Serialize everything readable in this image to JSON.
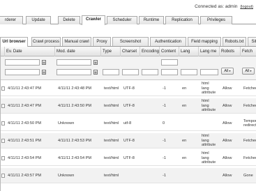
{
  "header": {
    "connected_label": "Connected as: admin",
    "logout_label": "(logout)"
  },
  "main_tabs": [
    {
      "label": "rderer"
    },
    {
      "label": "Update"
    },
    {
      "label": "Delete"
    },
    {
      "label": "Crawler"
    },
    {
      "label": "Scheduler"
    },
    {
      "label": "Runtime"
    },
    {
      "label": "Replication"
    },
    {
      "label": "Privileges"
    }
  ],
  "sub_tabs": [
    {
      "label": "Url browser"
    },
    {
      "label": "Crawl process"
    },
    {
      "label": "Manual crawl"
    },
    {
      "label": "Proxy"
    },
    {
      "label": "Screenshot"
    },
    {
      "label": "Authentication"
    },
    {
      "label": "Field mapping"
    },
    {
      "label": "Robots.txt"
    },
    {
      "label": "Sit"
    }
  ],
  "columns": [
    {
      "label": "Ev. Date"
    },
    {
      "label": "Mod. date"
    },
    {
      "label": "Type"
    },
    {
      "label": "Charset"
    },
    {
      "label": "Encoding"
    },
    {
      "label": "Content"
    },
    {
      "label": "Lang"
    },
    {
      "label": "Lang me"
    },
    {
      "label": "Robots"
    },
    {
      "label": "Fetch"
    }
  ],
  "filters": {
    "robots_select": "All",
    "fetch_select": "All"
  },
  "rows": [
    {
      "ev": "4/11/11 2:43:47 PM",
      "mod": "4/11/11 2:43:48 PM",
      "type": "text/html",
      "charset": "UTF-8",
      "content": "-1",
      "lang": "en",
      "lang_method": [
        "html",
        "lang",
        "attribute"
      ],
      "robots": "Allow",
      "fetch": [
        "Fetched"
      ]
    },
    {
      "ev": "4/11/11 2:43:47 PM",
      "mod": "4/11/11 2:43:50 PM",
      "type": "text/html",
      "charset": "UTF-8",
      "content": "-1",
      "lang": "en",
      "lang_method": [
        "html",
        "lang",
        "attribute"
      ],
      "robots": "Allow",
      "fetch": [
        "Fetched"
      ]
    },
    {
      "ev": "4/11/11 2:43:50 PM",
      "mod": "Unknown",
      "type": "text/html",
      "charset": "utf-8",
      "content": "0",
      "lang": "",
      "lang_method": [],
      "robots": "Allow",
      "fetch": [
        "Tempora",
        "redirect"
      ]
    },
    {
      "ev": "4/11/11 2:43:51 PM",
      "mod": "4/11/11 2:43:53 PM",
      "type": "text/html",
      "charset": "UTF-8",
      "content": "-1",
      "lang": "en",
      "lang_method": [
        "html",
        "lang",
        "attribute"
      ],
      "robots": "Allow",
      "fetch": [
        "Fetched"
      ]
    },
    {
      "ev": "4/11/11 2:43:54 PM",
      "mod": "4/11/11 2:43:54 PM",
      "type": "text/html",
      "charset": "UTF-8",
      "content": "-1",
      "lang": "en",
      "lang_method": [
        "html",
        "lang",
        "attribute"
      ],
      "robots": "Allow",
      "fetch": [
        "Fetched"
      ]
    },
    {
      "ev": "4/11/11 2:43:57 PM",
      "mod": "Unknown",
      "type": "text/html",
      "charset": "",
      "content": "-1",
      "lang": "",
      "lang_method": [],
      "robots": "Allow",
      "fetch": [
        "Gone"
      ]
    }
  ]
}
